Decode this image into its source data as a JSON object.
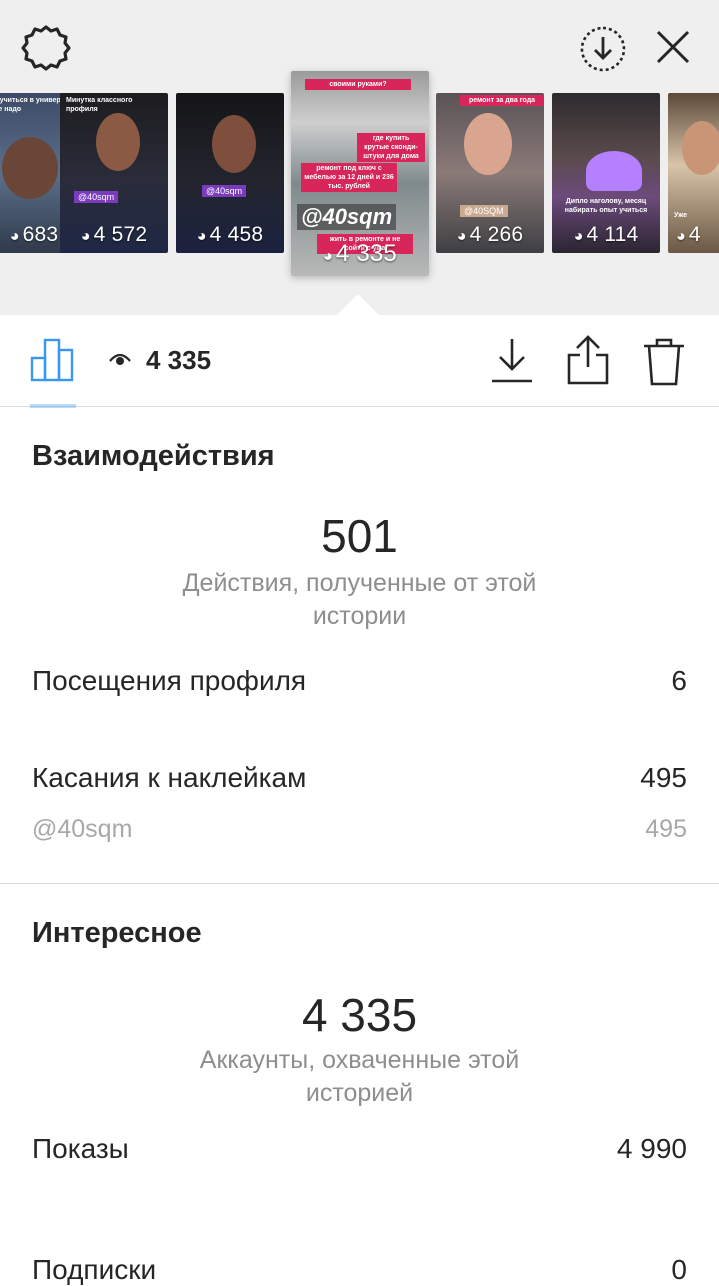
{
  "header": {
    "settings_icon": "gear-icon",
    "download_icon": "download-circle-icon",
    "close_icon": "close-icon"
  },
  "stories": [
    {
      "views": "683",
      "caption": "Как учиться в универе и тоже надо"
    },
    {
      "views": "4 572",
      "caption": "Минутка классного профиля",
      "tag": "@40sqm"
    },
    {
      "views": "4 458",
      "tag": "@40sqm"
    },
    {
      "views": "4 335",
      "caption_top": "своими руками?",
      "caption_a": "где купить крутые сконди-штуки для дома",
      "caption_b": "ремонт под ключ с мебелью за 12 дней и 236 тыс. рублей",
      "caption_c": "жить в ремонте и не сойти с ума",
      "big_tag": "@40sqm"
    },
    {
      "views": "4 266",
      "caption": "ремонт за два года",
      "tag": "@40SQM"
    },
    {
      "views": "4 114",
      "caption": "Дипло наголову, месяц набирать опыт учиться"
    },
    {
      "views": "4",
      "caption": "Уже"
    }
  ],
  "toolbar": {
    "view_count": "4 335",
    "chart_icon": "bar-chart-icon",
    "eye_icon": "eye-icon",
    "download_icon": "download-icon",
    "share_icon": "share-icon",
    "trash_icon": "trash-icon"
  },
  "interactions": {
    "title": "Взаимодействия",
    "total": "501",
    "total_caption": "Действия, полученные от этой истории",
    "rows": [
      {
        "label": "Посещения профиля",
        "value": "6"
      },
      {
        "label": "Касания к наклейкам",
        "value": "495"
      }
    ],
    "sub_rows": [
      {
        "label": "@40sqm",
        "value": "495"
      }
    ]
  },
  "discovery": {
    "title": "Интересное",
    "total": "4 335",
    "total_caption": "Аккаунты, охваченные этой историей",
    "rows": [
      {
        "label": "Показы",
        "value": "4 990"
      },
      {
        "label": "Подписки",
        "value": "0"
      }
    ]
  },
  "colors": {
    "accent": "#3897f0",
    "text": "#262626",
    "secondary": "#8e8e8e",
    "tag_red": "#d8265a",
    "tag_purple": "#7a3cbd"
  }
}
